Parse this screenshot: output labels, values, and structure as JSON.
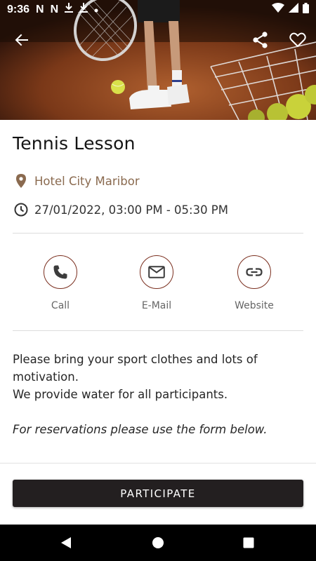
{
  "status_bar": {
    "time": "9:36",
    "left_icons": [
      "netflix-icon",
      "netflix-icon",
      "download-icon",
      "download-icon",
      "dot-icon"
    ],
    "right_icons": [
      "wifi-icon",
      "signal-icon",
      "battery-icon"
    ]
  },
  "app_bar": {
    "back_icon": "arrow-left-icon",
    "share_icon": "share-icon",
    "favorite_icon": "heart-outline-icon"
  },
  "event": {
    "title": "Tennis Lesson",
    "location": "Hotel City Maribor",
    "datetime": "27/01/2022, 03:00 PM - 05:30 PM"
  },
  "actions": [
    {
      "label": "Call",
      "icon": "phone-icon"
    },
    {
      "label": "E-Mail",
      "icon": "mail-icon"
    },
    {
      "label": "Website",
      "icon": "link-icon"
    }
  ],
  "description": {
    "line1": "Please bring your sport clothes and lots of motivation.",
    "line2": "We provide water for all participants.",
    "note": "For reservations please use the form below."
  },
  "cta": {
    "label": "PARTICIPATE"
  },
  "colors": {
    "accent": "#7a2e1e",
    "location_text": "#8a6a4f",
    "button_bg": "#231f20"
  }
}
